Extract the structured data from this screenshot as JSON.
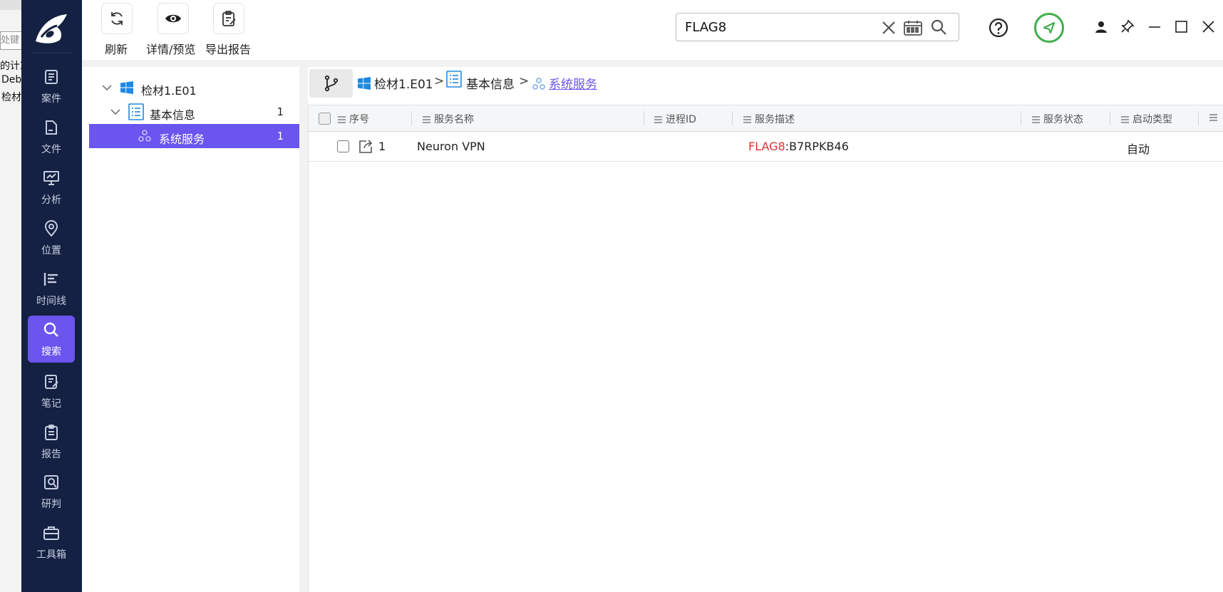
{
  "background_window": {
    "input_placeholder": "处键",
    "lines": [
      "的计算",
      "Deb",
      "检材"
    ]
  },
  "nav": {
    "items": [
      {
        "label": "案件",
        "icon": "case-icon"
      },
      {
        "label": "文件",
        "icon": "folder-icon"
      },
      {
        "label": "分析",
        "icon": "analysis-icon"
      },
      {
        "label": "位置",
        "icon": "location-icon"
      },
      {
        "label": "时间线",
        "icon": "timeline-icon"
      },
      {
        "label": "搜索",
        "icon": "search-icon",
        "active": true
      },
      {
        "label": "笔记",
        "icon": "notes-icon"
      },
      {
        "label": "报告",
        "icon": "report-icon"
      },
      {
        "label": "研判",
        "icon": "judge-icon"
      },
      {
        "label": "工具箱",
        "icon": "toolbox-icon"
      }
    ]
  },
  "toolbar": {
    "refresh_label": "刷新",
    "preview_label": "详情/预览",
    "export_label": "导出报告"
  },
  "search": {
    "value": "FLAG8"
  },
  "tree": {
    "root": {
      "label": "检材1.E01"
    },
    "group": {
      "label": "基本信息",
      "count": "1"
    },
    "leaf": {
      "label": "系统服务",
      "count": "1"
    }
  },
  "breadcrumb": {
    "items": [
      "检材1.E01",
      "基本信息",
      "系统服务"
    ],
    "separator": ">"
  },
  "table": {
    "columns": [
      "序号",
      "服务名称",
      "进程ID",
      "服务描述",
      "服务状态",
      "启动类型"
    ],
    "rows": [
      {
        "index": "1",
        "service_name": "Neuron VPN",
        "pid": "",
        "desc_highlight": "FLAG8",
        "desc_rest": ":B7RPKB46",
        "status": "",
        "start_type": "自动"
      }
    ]
  },
  "colors": {
    "rail_bg": "#142142",
    "accent": "#6a55ef",
    "highlight": "#e03030",
    "status_green": "#3fae4b"
  }
}
